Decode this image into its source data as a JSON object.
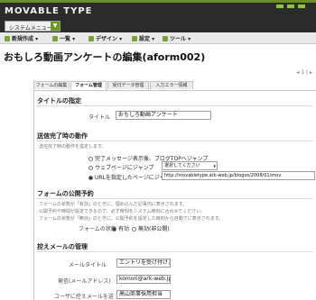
{
  "header": {
    "logo_text": "MOVABLE TYPE",
    "system_menu_label": "システムメニュー",
    "system_menu_arrow": "▼"
  },
  "toolbar": {
    "items": [
      {
        "label": "新規作成 ▾"
      },
      {
        "label": "一覧 ▾"
      },
      {
        "label": "デザイン ▾"
      },
      {
        "label": "設定 ▾"
      },
      {
        "label": "ツール ▾"
      }
    ]
  },
  "page": {
    "title": "おもしろ動画アンケートの編集(aform002)",
    "pager": "◂ 1 | ▸"
  },
  "tabs": [
    {
      "label": "フォームの編集"
    },
    {
      "label": "フォーム管理",
      "active": true
    },
    {
      "label": "受付データ管理"
    },
    {
      "label": "入力エラー情報"
    }
  ],
  "sections": {
    "title_spec": {
      "heading": "タイトルの指定",
      "label": "タイトル",
      "value": "おもしろ動画アンケート"
    },
    "after_send": {
      "heading": "送信完了時の動作",
      "note": "送信完了時の動作を指定します。",
      "option1": "完了メッセージ表示後、ブログTOPへジャンプ",
      "option2": "ウェブページにジャンプ",
      "option2_select": "選択してください",
      "option3": "URLを指定したページにジャンプ",
      "option3_value": "http://movabletype.ark-web.jp/blogos/2008/01/mov"
    },
    "publish": {
      "heading": "フォームの公開予約",
      "note1": "フォームの状態が「有効」のときに、埋め込んだ記事内に表示されます。",
      "note2": "公開予約や時間が設定できるので、必ず時刻をシステム時刻に合わせてください。",
      "note3": "フォームの状態が「無効」のときに、公開予約を設定した時刻から自動でに表示されます。",
      "label": "フォームの状態",
      "opt_on": "有効",
      "opt_off": "無効(非公開)"
    },
    "mail": {
      "heading": "控えメールの管理",
      "mail_title_label": "メールタイトル",
      "mail_title_value": "エントリを受け付けました",
      "from_label": "発信(メールアドレス)",
      "from_value": "komori@ark-web.jp",
      "user_label": "ユーザに控えメールを送",
      "user_value": "高山商事採用担当"
    }
  },
  "colors": {
    "header_bg": "#2b2b2b",
    "accent_green": "#7aa237",
    "toolbar_bg": "#e9e9e9"
  }
}
